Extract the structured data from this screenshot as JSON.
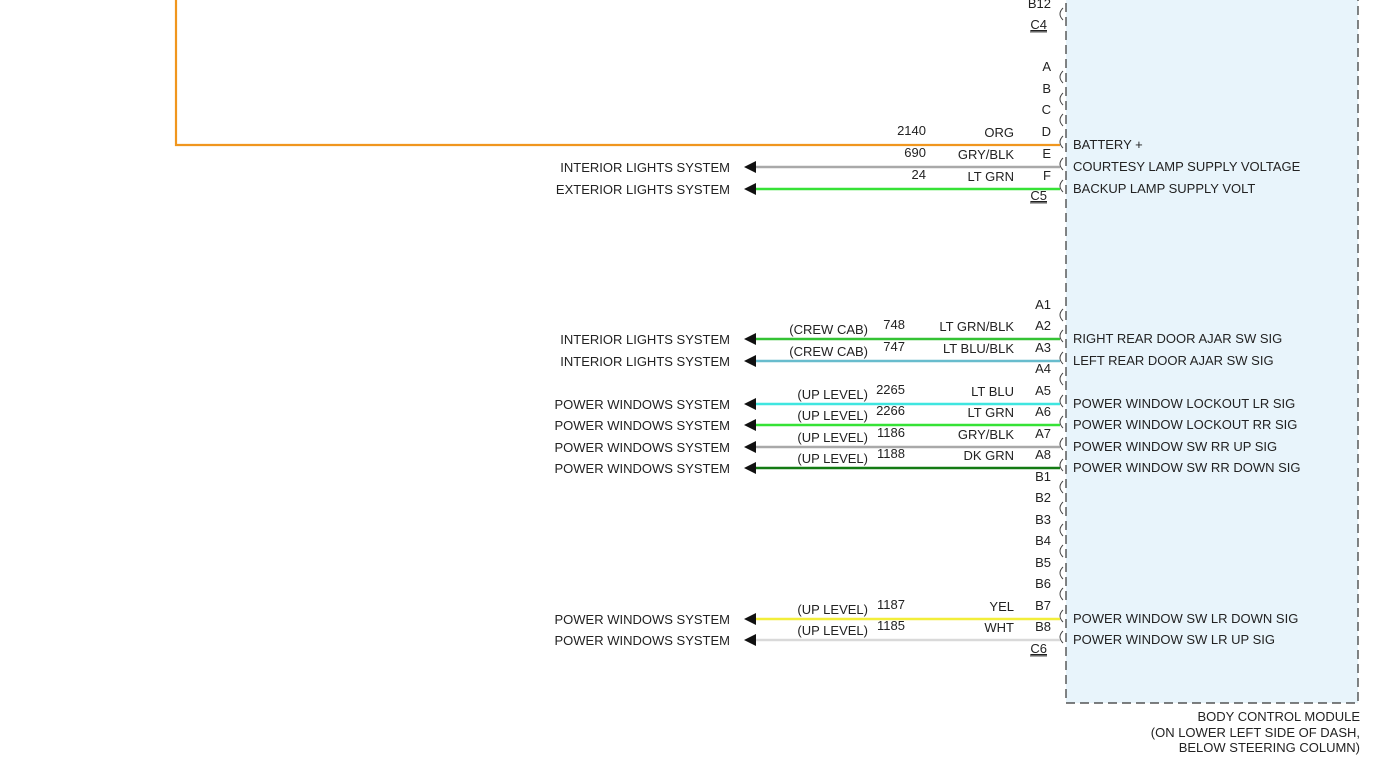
{
  "module": {
    "caption_lines": [
      "BODY CONTROL MODULE",
      "(ON LOWER LEFT SIDE OF DASH,",
      "BELOW STEERING COLUMN)"
    ],
    "fill": "#e8f4fb"
  },
  "connectors": [
    {
      "name": "C4",
      "pins": [
        "B12"
      ]
    },
    {
      "name": "C5",
      "pins": [
        "A",
        "B",
        "C",
        "D",
        "E",
        "F"
      ]
    },
    {
      "name": "C6",
      "pins": [
        "A1",
        "A2",
        "A3",
        "A4",
        "A5",
        "A6",
        "A7",
        "A8",
        "B1",
        "B2",
        "B3",
        "B4",
        "B5",
        "B6",
        "B7",
        "B8"
      ]
    }
  ],
  "circuits": [
    {
      "pin": "D",
      "circuit": "2140",
      "color_label": "ORG",
      "color": "#f0961e",
      "signal": "BATTERY +",
      "destination": "",
      "option": ""
    },
    {
      "pin": "E",
      "circuit": "690",
      "color_label": "GRY/BLK",
      "color": "#a9a9a9",
      "signal": "COURTESY LAMP SUPPLY VOLTAGE",
      "destination": "INTERIOR LIGHTS SYSTEM",
      "option": ""
    },
    {
      "pin": "F",
      "circuit": "24",
      "color_label": "LT GRN",
      "color": "#36e236",
      "signal": "BACKUP LAMP SUPPLY VOLT",
      "destination": "EXTERIOR LIGHTS SYSTEM",
      "option": ""
    },
    {
      "pin": "A2",
      "circuit": "748",
      "color_label": "LT GRN/BLK",
      "color": "#34c234",
      "signal": "RIGHT REAR DOOR AJAR SW SIG",
      "destination": "INTERIOR LIGHTS SYSTEM",
      "option": "(CREW CAB)"
    },
    {
      "pin": "A3",
      "circuit": "747",
      "color_label": "LT BLU/BLK",
      "color": "#68bccd",
      "signal": "LEFT REAR DOOR AJAR SW SIG",
      "destination": "INTERIOR LIGHTS SYSTEM",
      "option": "(CREW CAB)"
    },
    {
      "pin": "A5",
      "circuit": "2265",
      "color_label": "LT BLU",
      "color": "#3fe6e0",
      "signal": "POWER WINDOW LOCKOUT LR SIG",
      "destination": "POWER WINDOWS SYSTEM",
      "option": "(UP LEVEL)"
    },
    {
      "pin": "A6",
      "circuit": "2266",
      "color_label": "LT GRN",
      "color": "#36e236",
      "signal": "POWER WINDOW LOCKOUT RR SIG",
      "destination": "POWER WINDOWS SYSTEM",
      "option": "(UP LEVEL)"
    },
    {
      "pin": "A7",
      "circuit": "1186",
      "color_label": "GRY/BLK",
      "color": "#a9a9a9",
      "signal": "POWER WINDOW SW RR UP SIG",
      "destination": "POWER WINDOWS SYSTEM",
      "option": "(UP LEVEL)"
    },
    {
      "pin": "A8",
      "circuit": "1188",
      "color_label": "DK GRN",
      "color": "#137a13",
      "signal": "POWER WINDOW SW RR DOWN SIG",
      "destination": "POWER WINDOWS SYSTEM",
      "option": "(UP LEVEL)"
    },
    {
      "pin": "B7",
      "circuit": "1187",
      "color_label": "YEL",
      "color": "#f2ee3a",
      "signal": "POWER WINDOW SW LR DOWN SIG",
      "destination": "POWER WINDOWS SYSTEM",
      "option": "(UP LEVEL)"
    },
    {
      "pin": "B8",
      "circuit": "1185",
      "color_label": "WHT",
      "color": "#d9d9d9",
      "signal": "POWER WINDOW SW LR UP SIG",
      "destination": "POWER WINDOWS SYSTEM",
      "option": "(UP LEVEL)"
    }
  ]
}
